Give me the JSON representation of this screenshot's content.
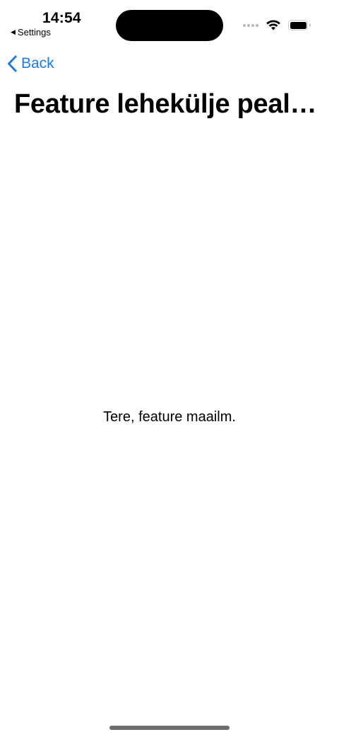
{
  "status_bar": {
    "time": "14:54",
    "back_app_label": "Settings",
    "back_app_icon": "left-triangle-icon",
    "wifi_icon": "wifi-icon",
    "battery_icon": "battery-icon",
    "battery_level": 1.0,
    "signal_icon": "cellular-dots-icon"
  },
  "nav": {
    "back_label": "Back",
    "back_icon": "chevron-left-icon",
    "accent_color": "#1a7cf5"
  },
  "page": {
    "title": "Feature lehekülje peal…",
    "body_text": "Tere, feature maailm."
  }
}
